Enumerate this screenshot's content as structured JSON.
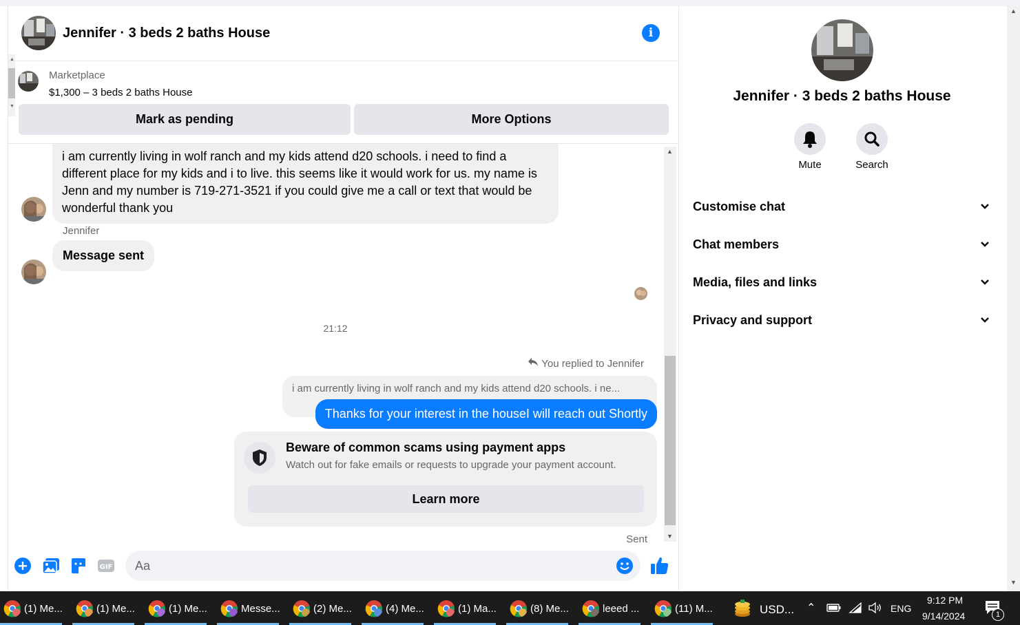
{
  "header": {
    "title": "Jennifer · 3 beds 2 baths House"
  },
  "marketplace": {
    "label": "Marketplace",
    "listing": "$1,300 – 3 beds 2 baths House",
    "mark_pending": "Mark as pending",
    "more_options": "More Options"
  },
  "messages": {
    "incoming_1": "i am currently living in wolf ranch and my kids attend d20 schools. i need to find a different place for my kids and i to live. this seems like it would work for us. my name is Jenn and my number is 719-271-3521 if you could give me a call or text that would be wonderful thank you",
    "sender_name": "Jennifer",
    "incoming_2": "Message sent",
    "timestamp": "21:12",
    "replied_to": "You replied to Jennifer",
    "quoted": "i am currently living in wolf ranch and my kids attend d20 schools. i ne...",
    "outgoing": "Thanks for your interest in the houseI will reach out Shortly",
    "scam_title": "Beware of common scams using payment apps",
    "scam_desc": "Watch out for fake emails or requests to upgrade your payment account.",
    "learn_more": "Learn more",
    "sent_status": "Sent"
  },
  "composer": {
    "placeholder": "Aa",
    "gif_label": "GIF"
  },
  "info_panel": {
    "title": "Jennifer · 3 beds 2 baths House",
    "mute": "Mute",
    "search": "Search",
    "sections": [
      "Customise chat",
      "Chat members",
      "Media, files and links",
      "Privacy and support"
    ]
  },
  "taskbar": {
    "tasks": [
      "(1) Me...",
      "(1) Me...",
      "(1) Me...",
      "Messe...",
      "(2) Me...",
      "(4) Me...",
      "(1) Ma...",
      "(8) Me...",
      "leeed ...",
      "(11) M..."
    ],
    "currency": "USD...",
    "lang": "ENG",
    "time": "9:12 PM",
    "date": "9/14/2024",
    "notif_count": "1"
  },
  "colors": {
    "messenger_blue": "#0a7cff",
    "bubble_gray": "#f0f0f0",
    "button_gray": "#e4e6eb",
    "taskbar_bg": "#1c1c1c"
  }
}
